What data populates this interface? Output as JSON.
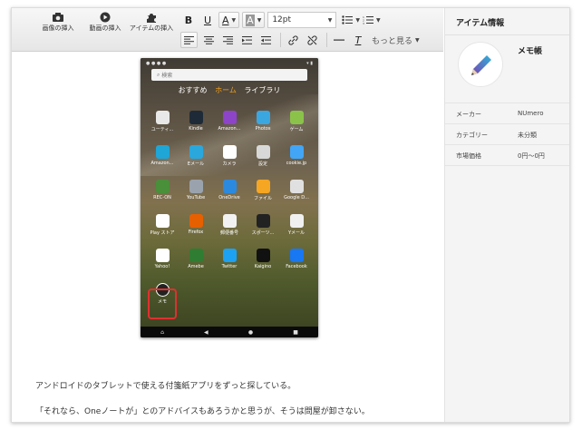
{
  "toolbar": {
    "insert_image": "画像の挿入",
    "insert_video": "動画の挿入",
    "insert_item": "アイテムの挿入",
    "bold": "B",
    "underline": "U",
    "font_color": "A",
    "bg_color": "A",
    "font_size": "12pt",
    "more": "もっと見る",
    "clear_format": "T"
  },
  "phone": {
    "search_placeholder": "検索",
    "tabs": [
      "おすすめ",
      "ホーム",
      "ライブラリ"
    ],
    "apps": [
      {
        "label": "ユーティ...",
        "color": "#e8e8e8"
      },
      {
        "label": "Kindle",
        "color": "#1e2a38"
      },
      {
        "label": "Amazon...",
        "color": "#8e44c8"
      },
      {
        "label": "Photos",
        "color": "#3ba7e0"
      },
      {
        "label": "ゲーム",
        "color": "#8bc34a"
      },
      {
        "label": "Amazon...",
        "color": "#1fa5d6"
      },
      {
        "label": "Eメール",
        "color": "#2aa7dd"
      },
      {
        "label": "カメラ",
        "color": "#ffffff"
      },
      {
        "label": "設定",
        "color": "#d8d8d8"
      },
      {
        "label": "cookie.jp",
        "color": "#42a5f5"
      },
      {
        "label": "REC-ON",
        "color": "#4a8f3a"
      },
      {
        "label": "YouTube",
        "color": "#9aa3ad"
      },
      {
        "label": "OneDrive",
        "color": "#2b8ae0"
      },
      {
        "label": "ファイル",
        "color": "#f5a623"
      },
      {
        "label": "Google D...",
        "color": "#e0e0e0"
      },
      {
        "label": "Play ストア",
        "color": "#ffffff"
      },
      {
        "label": "Firefox",
        "color": "#e66000"
      },
      {
        "label": "郵便番号",
        "color": "#f2f2f2"
      },
      {
        "label": "スポーツ...",
        "color": "#222222"
      },
      {
        "label": "Yメール",
        "color": "#f0f0f0"
      },
      {
        "label": "Yahoo!",
        "color": "#ffffff"
      },
      {
        "label": "Amebe",
        "color": "#2e7d32"
      },
      {
        "label": "Twitter",
        "color": "#1da1f2"
      },
      {
        "label": "Kaigino",
        "color": "#111111"
      },
      {
        "label": "Facebook",
        "color": "#1877f2"
      },
      {
        "label": "メモ",
        "color": "#222222"
      }
    ]
  },
  "content": {
    "paragraph1": "アンドロイドのタブレットで使える付箋紙アプリをずっと探している。",
    "paragraph2": "「それなら、Oneノートが」とのアドバイスもあろうかと思うが、そうは問屋が卸さない。"
  },
  "sidebar": {
    "title": "アイテム情報",
    "item_name": "メモ帳",
    "rows": [
      {
        "key": "メーカー",
        "value": "NUmero"
      },
      {
        "key": "カテゴリー",
        "value": "未分類"
      },
      {
        "key": "市場価格",
        "value": "0円～0円"
      }
    ]
  }
}
